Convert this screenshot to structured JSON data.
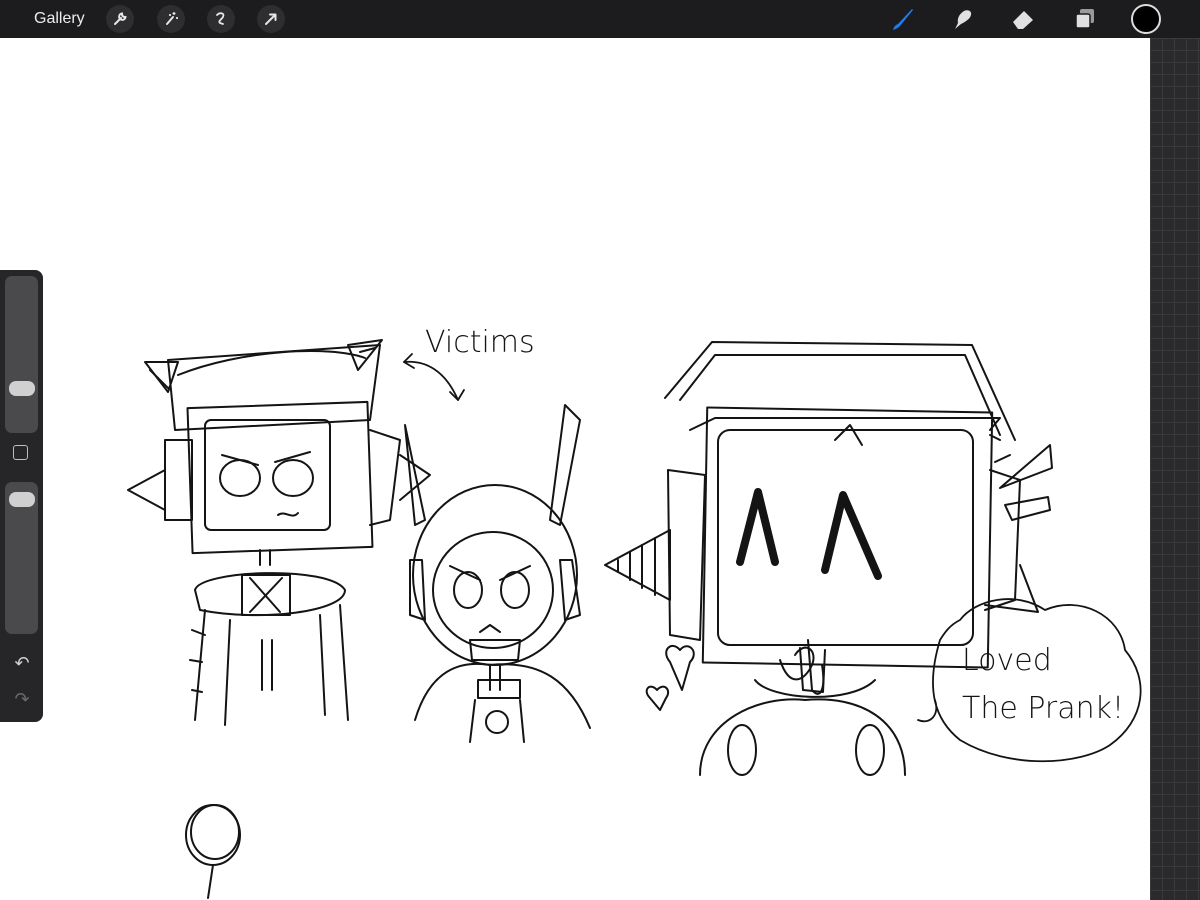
{
  "toolbar": {
    "gallery_label": "Gallery",
    "left_tools": [
      "wrench-icon",
      "magic-wand-icon",
      "selection-icon",
      "transform-arrow-icon"
    ],
    "right_tools": [
      "brush-icon",
      "smudge-icon",
      "eraser-icon",
      "layers-icon"
    ],
    "active_tool": "brush",
    "accent_color": "#1e7cf2",
    "current_color": "#000000"
  },
  "sidebar": {
    "brush_size_slider": 0.25,
    "opacity_slider": 0.05,
    "icons": [
      "modify-square-icon",
      "undo-icon",
      "redo-icon"
    ]
  },
  "drawing": {
    "annotation_victims": "Victims",
    "speech_line1": "Loved",
    "speech_line2": "The Prank!"
  }
}
